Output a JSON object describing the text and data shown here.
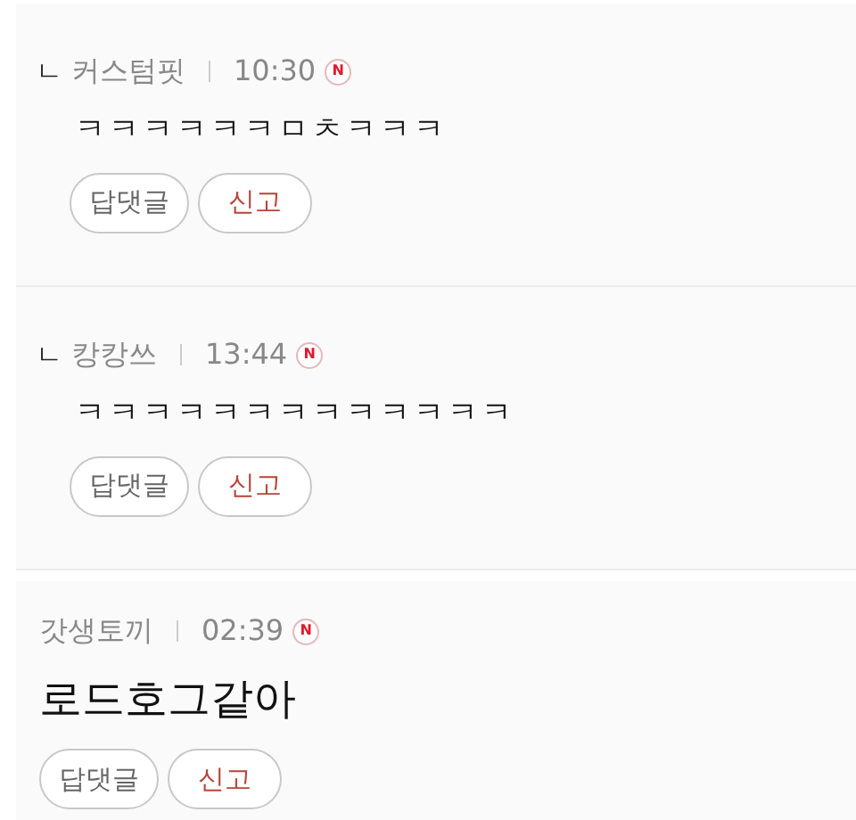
{
  "comments": [
    {
      "kind": "reply",
      "reply_mark": "ㄴ",
      "author": "커스텀핏",
      "time": "10:30",
      "new_badge": "N",
      "text": "ㅋㅋㅋㅋㅋㅋㅁㅊㅋㅋㅋ",
      "buttons": [
        "답댓글",
        "신고"
      ]
    },
    {
      "kind": "reply",
      "reply_mark": "ㄴ",
      "author": "캉캉쓰",
      "time": "13:44",
      "new_badge": "N",
      "text": "ㅋㅋㅋㅋㅋㅋㅋㅋㅋㅋㅋㅋㅋ",
      "buttons": [
        "답댓글",
        "신고"
      ]
    },
    {
      "kind": "comment",
      "author": "갓생토끼",
      "time": "02:39",
      "new_badge": "N",
      "text": "로드호그같아",
      "buttons": [
        "답댓글",
        "신고"
      ]
    }
  ]
}
